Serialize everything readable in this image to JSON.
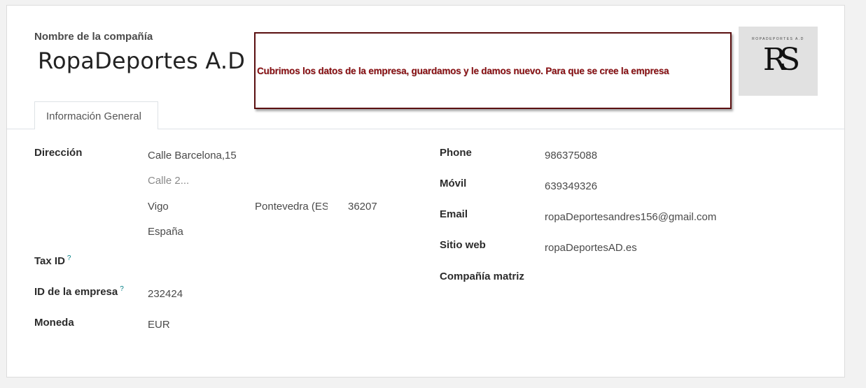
{
  "header": {
    "name_label": "Nombre de la compañía",
    "company_name": "RopaDeportes A.D"
  },
  "annotation": {
    "text": "Cubrimos los datos de la empresa, guardamos y le damos nuevo. Para que se cree la empresa",
    "color": "#8b0f12",
    "border_color": "#5a0f10"
  },
  "logo": {
    "small_text": "ROPADEPORTES A.D",
    "monogram": "RS"
  },
  "tabs": [
    {
      "label": "Información General"
    }
  ],
  "form": {
    "address": {
      "label": "Dirección",
      "street": "Calle Barcelona,15",
      "street2_placeholder": "Calle 2...",
      "city": "Vigo",
      "state": "Pontevedra (ES)",
      "zip": "36207",
      "country": "España"
    },
    "tax_id": {
      "label": "Tax ID",
      "help": "?"
    },
    "company_id": {
      "label": "ID de la empresa",
      "help": "?",
      "value": "232424"
    },
    "currency": {
      "label": "Moneda",
      "value": "EUR"
    },
    "phone": {
      "label": "Phone",
      "value": "986375088"
    },
    "mobile": {
      "label": "Móvil",
      "value": "639349326"
    },
    "email": {
      "label": "Email",
      "value": "ropaDeportesandres156@gmail.com"
    },
    "website": {
      "label": "Sitio web",
      "value": "ropaDeportesAD.es"
    },
    "parent_company": {
      "label": "Compañía matriz",
      "value": ""
    }
  }
}
